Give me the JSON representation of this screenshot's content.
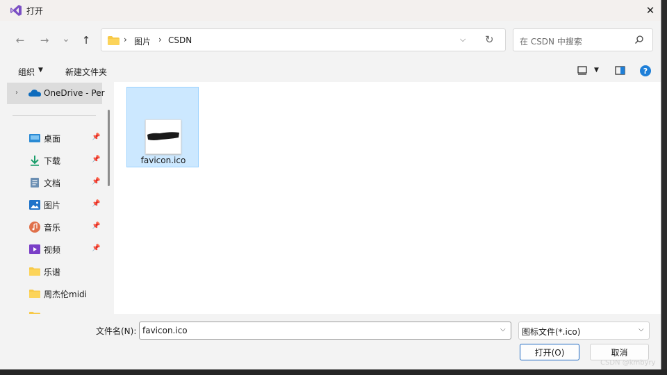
{
  "window": {
    "title": "打开",
    "close_glyph": "✕"
  },
  "nav": {
    "back_glyph": "←",
    "forward_glyph": "→",
    "recent_glyph": "⌄",
    "up_glyph": "↑"
  },
  "address": {
    "breadcrumbs": [
      "图片",
      "CSDN"
    ],
    "separator": "›",
    "dropdown_glyph": "⌵",
    "refresh_glyph": "↻"
  },
  "search": {
    "placeholder": "在 CSDN 中搜索",
    "icon": "search-icon"
  },
  "toolbar": {
    "organize_label": "组织",
    "new_folder_label": "新建文件夹",
    "caret_glyph": "▼",
    "help_glyph": "?"
  },
  "sidebar": {
    "top_item": {
      "label": "OneDrive - Per",
      "icon": "onedrive-icon",
      "chevron": "›"
    },
    "pin_glyph": "📌",
    "items": [
      {
        "label": "桌面",
        "icon": "desktop-icon",
        "pinned": true
      },
      {
        "label": "下载",
        "icon": "download-icon",
        "pinned": true
      },
      {
        "label": "文档",
        "icon": "documents-icon",
        "pinned": true
      },
      {
        "label": "图片",
        "icon": "pictures-icon",
        "pinned": true
      },
      {
        "label": "音乐",
        "icon": "music-icon",
        "pinned": true
      },
      {
        "label": "视频",
        "icon": "videos-icon",
        "pinned": true
      },
      {
        "label": "乐谱",
        "icon": "folder-icon",
        "pinned": false
      },
      {
        "label": "周杰伦midi",
        "icon": "folder-icon",
        "pinned": false
      }
    ]
  },
  "files": [
    {
      "name": "favicon.ico",
      "selected": true
    }
  ],
  "bottom": {
    "filename_label": "文件名(N):",
    "filename_value": "favicon.ico",
    "filetype_value": "图标文件(*.ico)",
    "dropdown_glyph": "⌵",
    "open_label": "打开(O)",
    "cancel_label": "取消"
  },
  "watermark": "CSDN @kmbyry",
  "colors": {
    "accent": "#1e7fd8",
    "selection": "#cce8ff",
    "selection_border": "#99d1ff",
    "folder": "#f7c948"
  }
}
